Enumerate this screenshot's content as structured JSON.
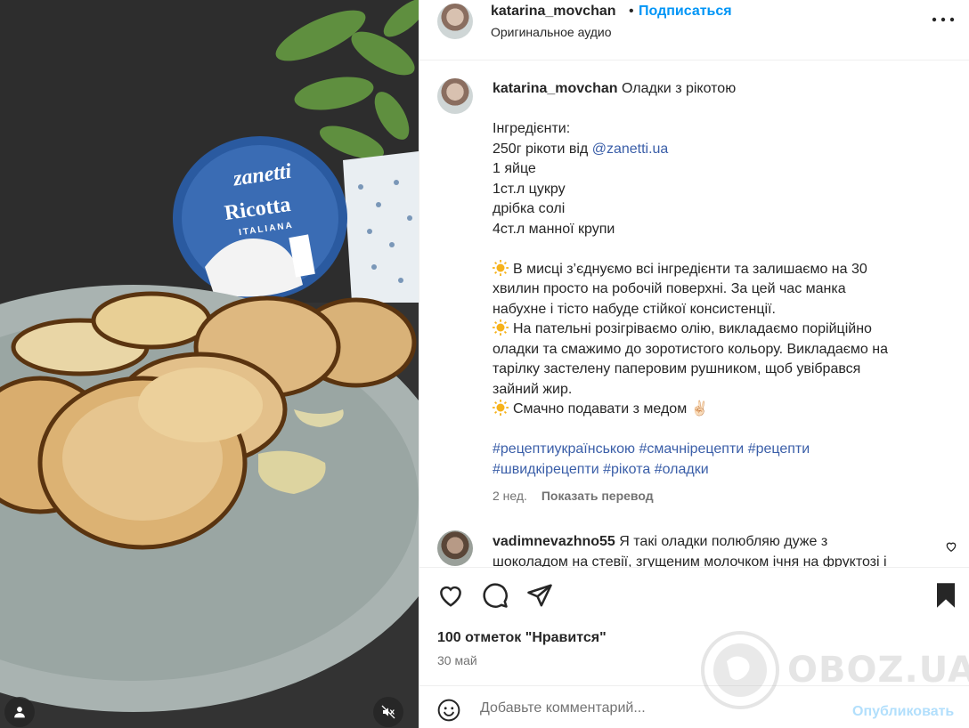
{
  "header": {
    "username": "katarina_movchan",
    "separator": "•",
    "follow_label": "Подписаться",
    "audio_label": "Оригинальное аудио"
  },
  "photo": {
    "ricotta_brand": "zanetti",
    "ricotta_name": "Ricotta",
    "ricotta_sub": "ITALIANA"
  },
  "caption": {
    "username": "katarina_movchan",
    "title": "Оладки з рікотою",
    "lines": {
      "l1": "Інгредієнти:",
      "l2": "250г рікоти від ",
      "l2_mention": "@zanetti.ua",
      "l3": "1 яйце",
      "l4": "1ст.л цукру",
      "l5": "дрібка солі",
      "l6": "4ст.л манної крупи",
      "l7": "В мисці з’єднуємо всі інгредієнти та залишаємо на 30",
      "l8": "хвилин просто на робочій поверхні. За цей час манка",
      "l9": "набухне і тісто набуде стійкої консистенції.",
      "l10": "На пательні розігріваємо олію, викладаємо порійційно",
      "l11": "оладки та смажимо до зоротистого кольору. Викладаємо на",
      "l12": "тарілку застелену паперовим рушником, щоб увібрався",
      "l13": "зайний жир.",
      "l14": "Смачно подавати з медом",
      "l14_emoji": "✌🏻"
    },
    "hashtags": {
      "h1": "#рецептиукраїнською",
      "h2": "#смачнірецепти",
      "h3": "#рецепти",
      "h4": "#швидкірецепти",
      "h5": "#рікота",
      "h6": "#оладки"
    },
    "age": "2 нед.",
    "translate_label": "Показать перевод"
  },
  "comment": {
    "username": "vadimnevazhno55",
    "text_line1": " Я такі оладки полюбляю дуже з",
    "text_line2": "шоколадом на стевії, згущеним молочком ічня на фруктозі і"
  },
  "stats": {
    "likes": "100 отметок \"Нравится\"",
    "date": "30 май"
  },
  "comment_box": {
    "placeholder": "Добавьте комментарий...",
    "publish_label": "Опубликовать"
  },
  "watermark": "OBOZ.UA",
  "icons": {
    "like": "heart-icon",
    "comment": "comment-icon",
    "share": "send-icon",
    "save": "bookmark-icon",
    "emoji": "smiley-icon",
    "more": "more-horizontal-icon",
    "tags": "user-tag-icon",
    "mute": "mute-icon",
    "bullet": "sun-emoji"
  },
  "colors": {
    "link": "#0095f6",
    "hashtag": "#3a5ea8",
    "muted": "#737373",
    "publish_disabled": "#b2dffc"
  }
}
